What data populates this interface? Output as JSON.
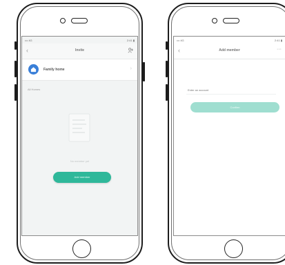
{
  "screen1": {
    "status": {
      "carrier": "••• 4G",
      "battery": "2:41 ▮"
    },
    "nav": {
      "back": "‹",
      "title": "Invite",
      "add_icon": "person-add-icon"
    },
    "home": {
      "name": "Family home",
      "chevron": "›",
      "icon": "home-icon"
    },
    "section_label": "All Homes",
    "empty_text": "No member yet",
    "button_label": "Add member"
  },
  "screen2": {
    "status": {
      "carrier": "••• 4G",
      "battery": "2:41 ▮"
    },
    "nav": {
      "back": "‹",
      "title": "Add member",
      "more": "···"
    },
    "input_placeholder": "Enter an account",
    "button_label": "Confirm"
  },
  "colors": {
    "accent": "#2fb89a",
    "accent_disabled": "#9fded0",
    "avatar": "#3a7fd8"
  }
}
